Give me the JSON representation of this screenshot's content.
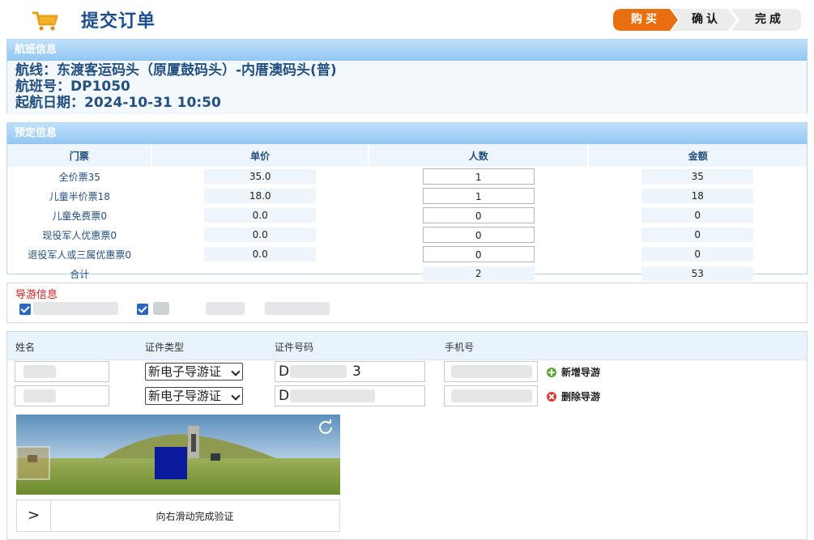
{
  "header": {
    "title": "提交订单",
    "steps": [
      "购买",
      "确认",
      "完成"
    ]
  },
  "flight": {
    "section_title": "航班信息",
    "route_label": "航线：",
    "route": "东渡客运码头（原厦鼓码头）-内厝澳码头(普)",
    "flight_no_label": "航班号：",
    "flight_no": "DP1050",
    "date_label": "起航日期：",
    "date": "2024-10-31 10:50"
  },
  "booking": {
    "section_title": "预定信息",
    "columns": [
      "门票",
      "单价",
      "人数",
      "金额"
    ],
    "rows": [
      {
        "name": "全价票35",
        "price": "35.0",
        "count": "1",
        "amount": "35"
      },
      {
        "name": "儿童半价票18",
        "price": "18.0",
        "count": "1",
        "amount": "18"
      },
      {
        "name": "儿童免费票0",
        "price": "0.0",
        "count": "0",
        "amount": "0"
      },
      {
        "name": "现役军人优惠票0",
        "price": "0.0",
        "count": "0",
        "amount": "0"
      },
      {
        "name": "退役军人或三属优惠票0",
        "price": "0.0",
        "count": "0",
        "amount": "0"
      }
    ],
    "total": {
      "label": "合计",
      "count": "2",
      "amount": "53"
    }
  },
  "guide": {
    "section_title": "导游信息"
  },
  "form": {
    "columns": [
      "姓名",
      "证件类型",
      "证件号码",
      "手机号"
    ],
    "rows": [
      {
        "id_type": "新电子导游证",
        "id_prefix": "D",
        "id_suffix": "3",
        "action": "新增导游"
      },
      {
        "id_type": "新电子导游证",
        "id_prefix": "D",
        "id_suffix": "",
        "action": "删除导游"
      }
    ]
  },
  "captcha": {
    "handle_symbol": ">",
    "hint": "向右滑动完成验证"
  },
  "colors": {
    "accent_orange": "#e86e0f",
    "header_blue": "#92c7f3",
    "title_blue": "#1c4f8e"
  }
}
